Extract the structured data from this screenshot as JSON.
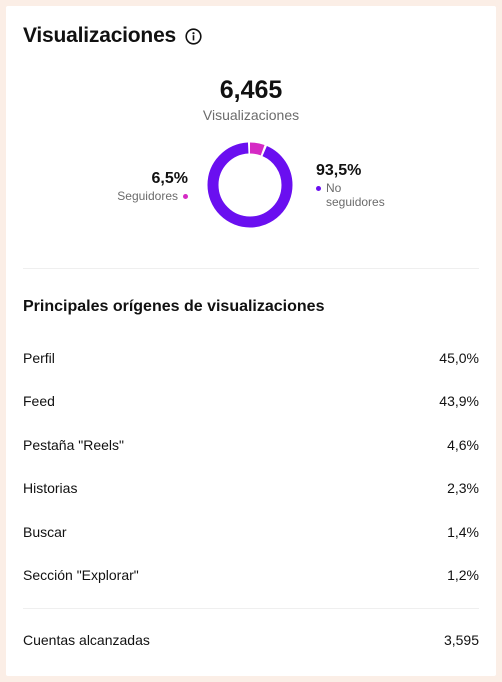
{
  "header": {
    "title": "Visualizaciones",
    "info_icon": "info-icon"
  },
  "total": {
    "value": "6,465",
    "label": "Visualizaciones"
  },
  "breakdown": {
    "followers": {
      "value": "6,5%",
      "label": "Seguidores",
      "fraction": 0.065,
      "color": "#d52ac4"
    },
    "non_followers": {
      "value": "93,5%",
      "label_line1": "No",
      "label_line2": "seguidores",
      "fraction": 0.935,
      "color": "#6a0ff0"
    }
  },
  "sources": {
    "title": "Principales orígenes de visualizaciones",
    "rows": [
      {
        "label": "Perfil",
        "value": "45,0%"
      },
      {
        "label": "Feed",
        "value": "43,9%"
      },
      {
        "label": "Pestaña \"Reels\"",
        "value": "4,6%"
      },
      {
        "label": "Historias",
        "value": "2,3%"
      },
      {
        "label": "Buscar",
        "value": "1,4%"
      },
      {
        "label": "Sección \"Explorar\"",
        "value": "1,2%"
      }
    ]
  },
  "footer": {
    "label": "Cuentas alcanzadas",
    "value": "3,595"
  }
}
